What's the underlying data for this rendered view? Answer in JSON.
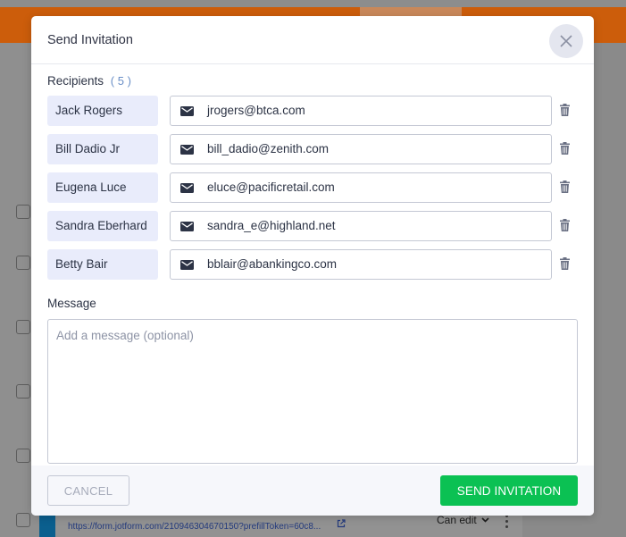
{
  "colors": {
    "accent_orange": "#cc5d0b",
    "send_green": "#0bc153",
    "name_chip_bg": "#e9ecfb",
    "count_blue": "#6a8fc7"
  },
  "background": {
    "link_text": "https://form.jotform.com/210946304670150?prefillToken=60c8...",
    "permission_label": "Can edit",
    "icons": [
      "external-link-icon",
      "chevron-down-icon",
      "kebab-menu-icon"
    ]
  },
  "modal": {
    "title": "Send Invitation",
    "close_icon": "close-icon",
    "recipients_label": "Recipients",
    "recipients_count": "( 5 )",
    "recipients": [
      {
        "name": "Jack Rogers",
        "email": "jrogers@btca.com"
      },
      {
        "name": "Bill Dadio Jr",
        "email": "bill_dadio@zenith.com"
      },
      {
        "name": "Eugena Luce",
        "email": "eluce@pacificretail.com"
      },
      {
        "name": "Sandra Eberhard",
        "email": "sandra_e@highland.net"
      },
      {
        "name": "Betty Bair",
        "email": "bblair@abankingco.com"
      }
    ],
    "email_icon": "envelope-icon",
    "delete_icon": "trash-icon",
    "message_label": "Message",
    "message_placeholder": "Add a message (optional)",
    "message_value": "",
    "cancel_label": "CANCEL",
    "send_label": "SEND INVITATION"
  }
}
